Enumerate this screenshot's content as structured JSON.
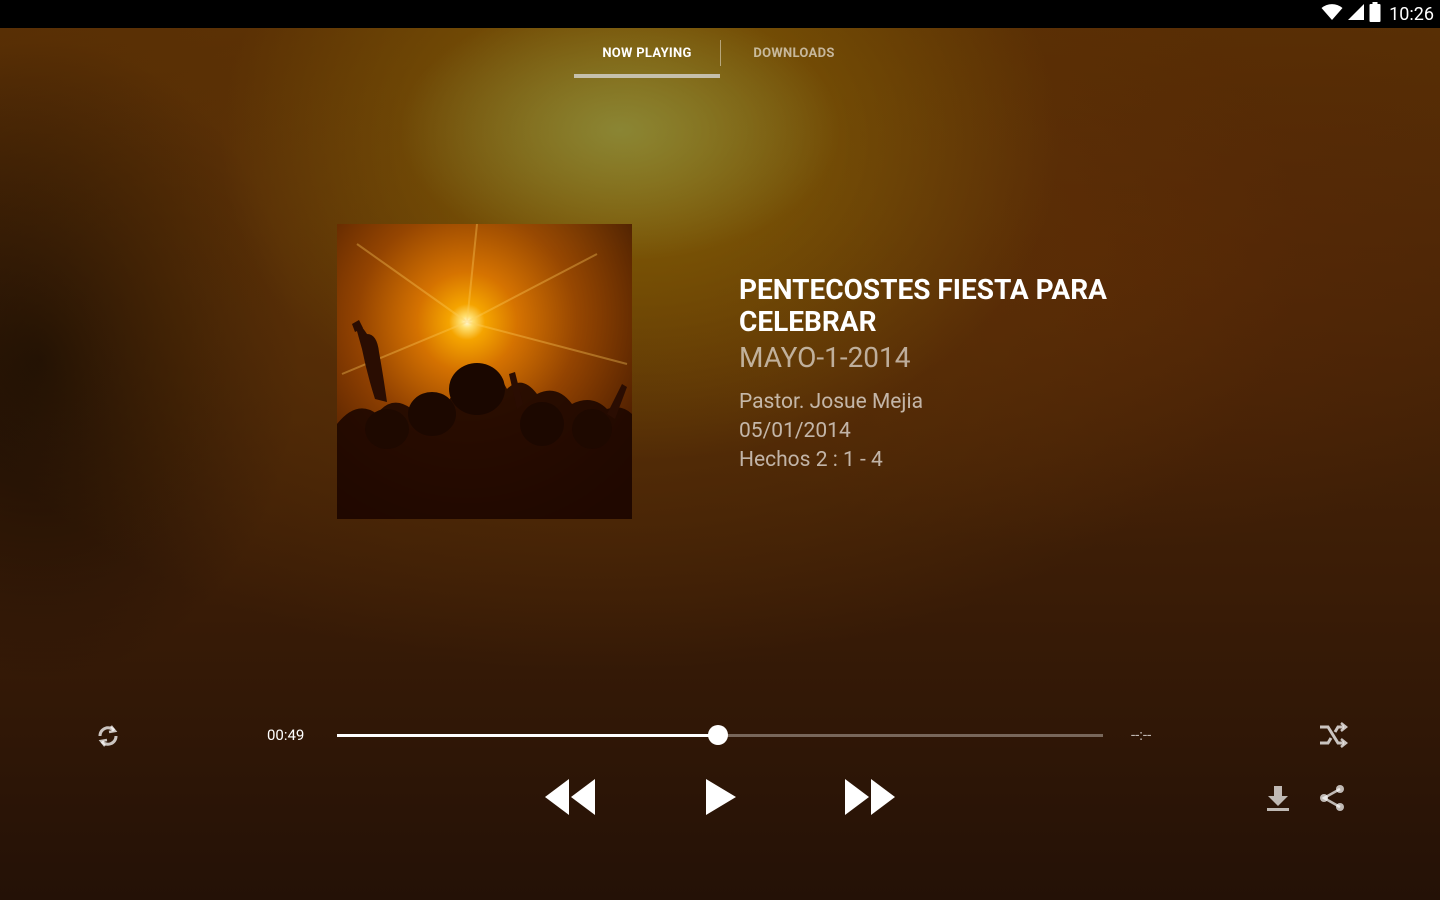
{
  "status_bar": {
    "time": "10:26",
    "icons": [
      "wifi-icon",
      "cell-signal-icon",
      "battery-icon"
    ]
  },
  "tabs": [
    {
      "label": "NOW PLAYING",
      "active": true
    },
    {
      "label": "DOWNLOADS",
      "active": false
    }
  ],
  "track": {
    "title": "PENTECOSTES FIESTA PARA CELEBRAR",
    "subtitle": "MAYO-1-2014",
    "speaker": "Pastor. Josue Mejia",
    "date": "05/01/2014",
    "reference": "Hechos 2 : 1 - 4"
  },
  "player": {
    "elapsed": "00:49",
    "total": "--:--",
    "progress_fraction": 0.497,
    "icons": {
      "repeat": "repeat-icon",
      "shuffle": "shuffle-icon",
      "rewind": "rewind-icon",
      "play": "play-icon",
      "fast_forward": "fast-forward-icon",
      "download": "download-icon",
      "share": "share-icon"
    }
  },
  "colors": {
    "background_top": "#5a3005",
    "background_glow": "#876405",
    "accent": "#ffffff"
  }
}
